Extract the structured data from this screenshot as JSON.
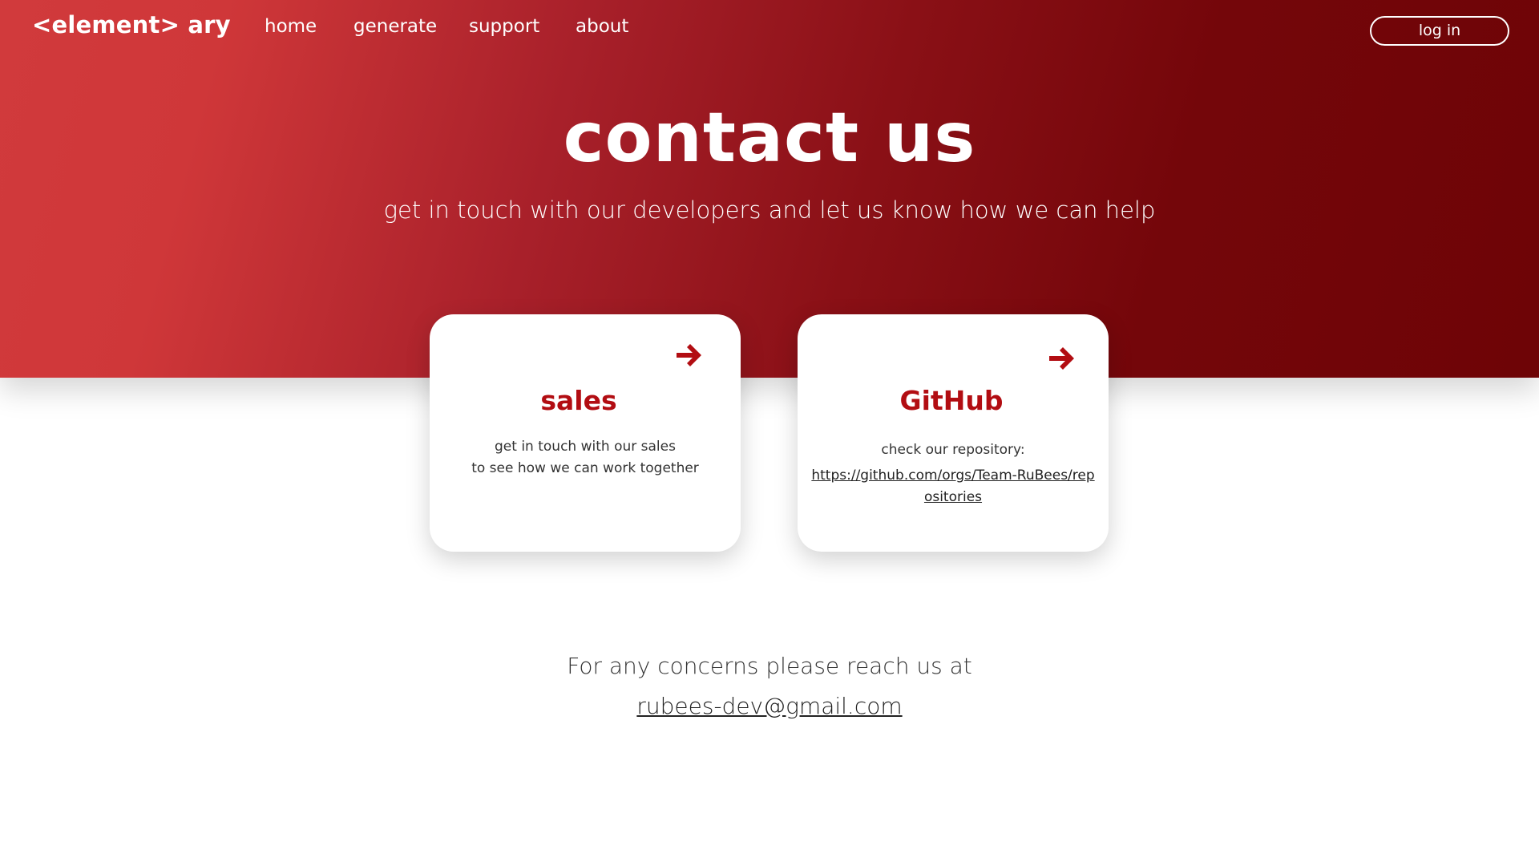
{
  "nav": {
    "logo": "<element> ary",
    "links": [
      {
        "label": "home"
      },
      {
        "label": "generate"
      },
      {
        "label": "support"
      },
      {
        "label": "about"
      }
    ],
    "login_label": "log in"
  },
  "hero": {
    "title": "contact us",
    "subtitle": "get in touch with our developers and let us know how we can help"
  },
  "cards": {
    "sales": {
      "title": "sales",
      "text_line1": "get in touch with our sales",
      "text_line2": "to see how we can work together",
      "icon": "arrow-right-icon"
    },
    "github": {
      "title": "GitHub",
      "text": "check our repository:",
      "link": "https://github.com/orgs/Team-RuBees/repositories",
      "icon": "arrow-right-icon"
    }
  },
  "footer": {
    "text": "For any concerns please reach us at",
    "email": "rubees-dev@gmail.com"
  },
  "colors": {
    "accent": "#b20d12",
    "hero_start": "#d13a3c",
    "hero_end": "#6e0406",
    "text_dark": "#333333"
  }
}
